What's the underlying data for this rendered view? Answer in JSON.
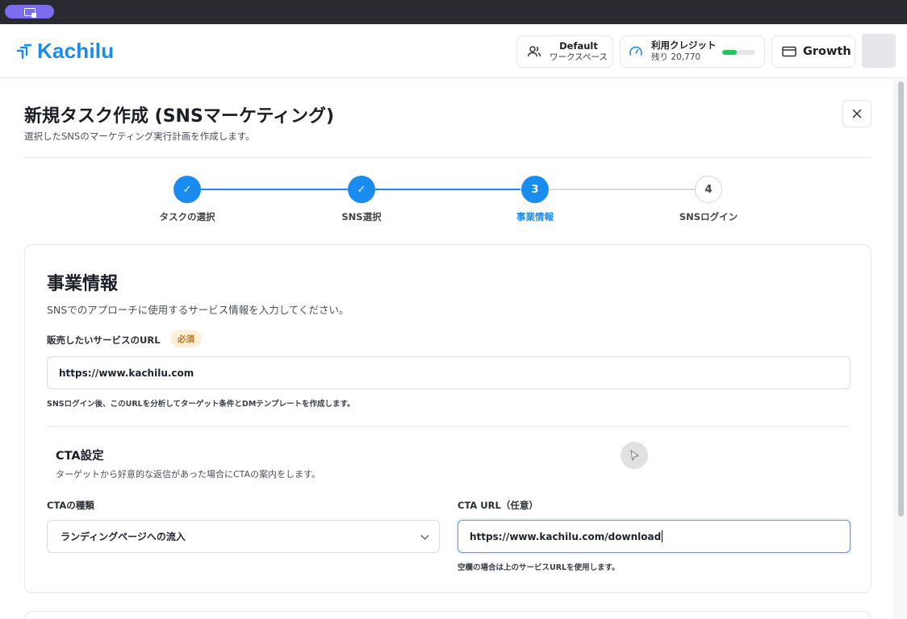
{
  "header": {
    "logo": "Kachilu",
    "workspace": {
      "title": "Default",
      "subtitle": "ワークスペース",
      "icon": "users-icon"
    },
    "credits": {
      "title": "利用クレジット",
      "remaining": "残り 20,770",
      "level": 0.45,
      "bar_color": "#22c55e",
      "icon": "gauge-icon"
    },
    "plan": {
      "label": "Growth",
      "icon": "card-icon"
    }
  },
  "page": {
    "title": "新規タスク作成 (SNSマーケティング)",
    "subtitle": "選択したSNSのマーケティング実行計画を作成します。"
  },
  "steps": [
    {
      "label": "タスクの選択",
      "state": "done",
      "mark": "✓"
    },
    {
      "label": "SNS選択",
      "state": "done",
      "mark": "✓"
    },
    {
      "label": "事業情報",
      "state": "active",
      "mark": "3"
    },
    {
      "label": "SNSログイン",
      "state": "pending",
      "mark": "4"
    }
  ],
  "section": {
    "title": "事業情報",
    "description": "SNSでのアプローチに使用するサービス情報を入力してください。",
    "service_url": {
      "label": "販売したいサービスのURL",
      "badge": "必須",
      "value": "https://www.kachilu.com",
      "hint": "SNSログイン後、このURLを分析してターゲット条件とDMテンプレートを作成します。"
    },
    "cta": {
      "title": "CTA設定",
      "description": "ターゲットから好意的な返信があった場合にCTAの案内をします。",
      "type_label": "CTAの種類",
      "type_value": "ランディングページへの流入",
      "url_label": "CTA URL（任意）",
      "url_value": "https://www.kachilu.com/download",
      "url_hint": "空欄の場合は上のサービスURLを使用します。"
    }
  },
  "colors": {
    "accent": "#1a8cf0",
    "badge_bg": "#fdf0d9",
    "badge_text": "#c4741a"
  }
}
